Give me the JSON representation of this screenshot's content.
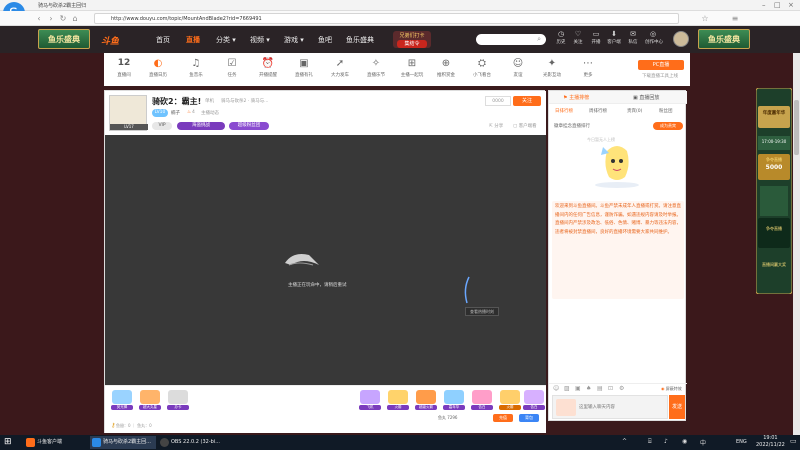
{
  "titlebar": {
    "title": "骑马与砍杀2霸主回归"
  },
  "addressbar": {
    "url": "http://www.douyu.com/topic/MountAndBlade2?rid=7669491"
  },
  "site": {
    "banner_left": "鱼乐盛典",
    "banner_right": "鱼乐盛典",
    "logo": "斗鱼",
    "nav": [
      "首页",
      "直播",
      "分类",
      "视频",
      "游戏",
      "鱼吧",
      "鱼乐盛典"
    ],
    "nav_active": "直播",
    "promo_line1": "兄弟们打卡",
    "promo_line2": "集结令",
    "search_placeholder": "",
    "tools": [
      "历史",
      "关注",
      "开播",
      "客户端",
      "私信",
      "创作中心"
    ]
  },
  "categories": {
    "items": [
      "直播间",
      "直播日历",
      "鱼音乐",
      "任务",
      "开播提醒",
      "直播有礼",
      "大力发车",
      "直播乐节",
      "主播一起玩",
      "推积赏金",
      "小飞看台",
      "友谊",
      "光影互动",
      "更多"
    ],
    "left_number": "12",
    "upload_button": "PC直播",
    "upload_text": "下载直播工具上线"
  },
  "stream": {
    "title": "骑砍2：霸主!",
    "tag1": "单机",
    "tag2": "骑马与砍杀2 · 骑马与...",
    "level": "LV10",
    "anchor_name": "楠子",
    "fans": "4",
    "report": "主播动态",
    "badge1": "VIP",
    "badge2": "海盗挑战",
    "badge3": "超级粉丝团",
    "anchor_level": "LV17",
    "room_num": "0000",
    "follow": "关注",
    "share": "分享",
    "client": "客户端看",
    "offline_text": "主播正在玩命中，请稍后重试",
    "playlist_label": "查看热播时刻",
    "fishball_text": "鱼丸 7296",
    "recharge": "充值",
    "bag": "背包",
    "ymoney": "鱼翅：0 ｜ 鱼丸：0",
    "gifts": [
      "荧光棒",
      "超大丸星",
      "办卡",
      "飞机",
      "火箭",
      "超级火箭",
      "嘉年华",
      "告白"
    ]
  },
  "chat": {
    "tab_left": "主播排榜",
    "tab_right": "直播回放",
    "subtabs": [
      "日排行榜",
      "周排行榜",
      "贵宾(0)",
      "粉丝团"
    ],
    "rank_line": "徽章挂念直播排行",
    "rank_button": "成为贵宾",
    "mascot_note": "今日暂无人上榜",
    "notice": "欢迎来到斗鱼直播间。斗鱼严禁未成年人直播或打赏。请注意直播间内的任何广告信息，谨防诈骗。如遇违规内容请及时举报。直播间内严禁涉及政治、低俗、色情、赌博、暴力等违法内容，违者将被封禁直播间，良好的直播环境需要大家共同维护。",
    "shield_label": "屏蔽特效",
    "input_placeholder": "这里输入聊天内容",
    "send": "发送"
  },
  "sidead": {
    "top_label": "年度嘉年华",
    "time_text": "17:00-19:30",
    "time_label": "争夺直播",
    "prize": "5000",
    "bottom_text1": "争夺直播",
    "bottom_text2": "直播间赢大奖"
  },
  "taskbar": {
    "items": [
      "斗鱼客户端",
      "骑马与砍杀2霸主回...",
      "OBS 22.0.2 (32-bi..."
    ],
    "lang": "ENG",
    "time": "19:01",
    "date": "2022/11/22"
  },
  "colors": {
    "accent": "#ff6d1a",
    "nav_bg": "#2a2326",
    "page_bg": "#3a1a1c",
    "notice_text": "#e8641a"
  }
}
